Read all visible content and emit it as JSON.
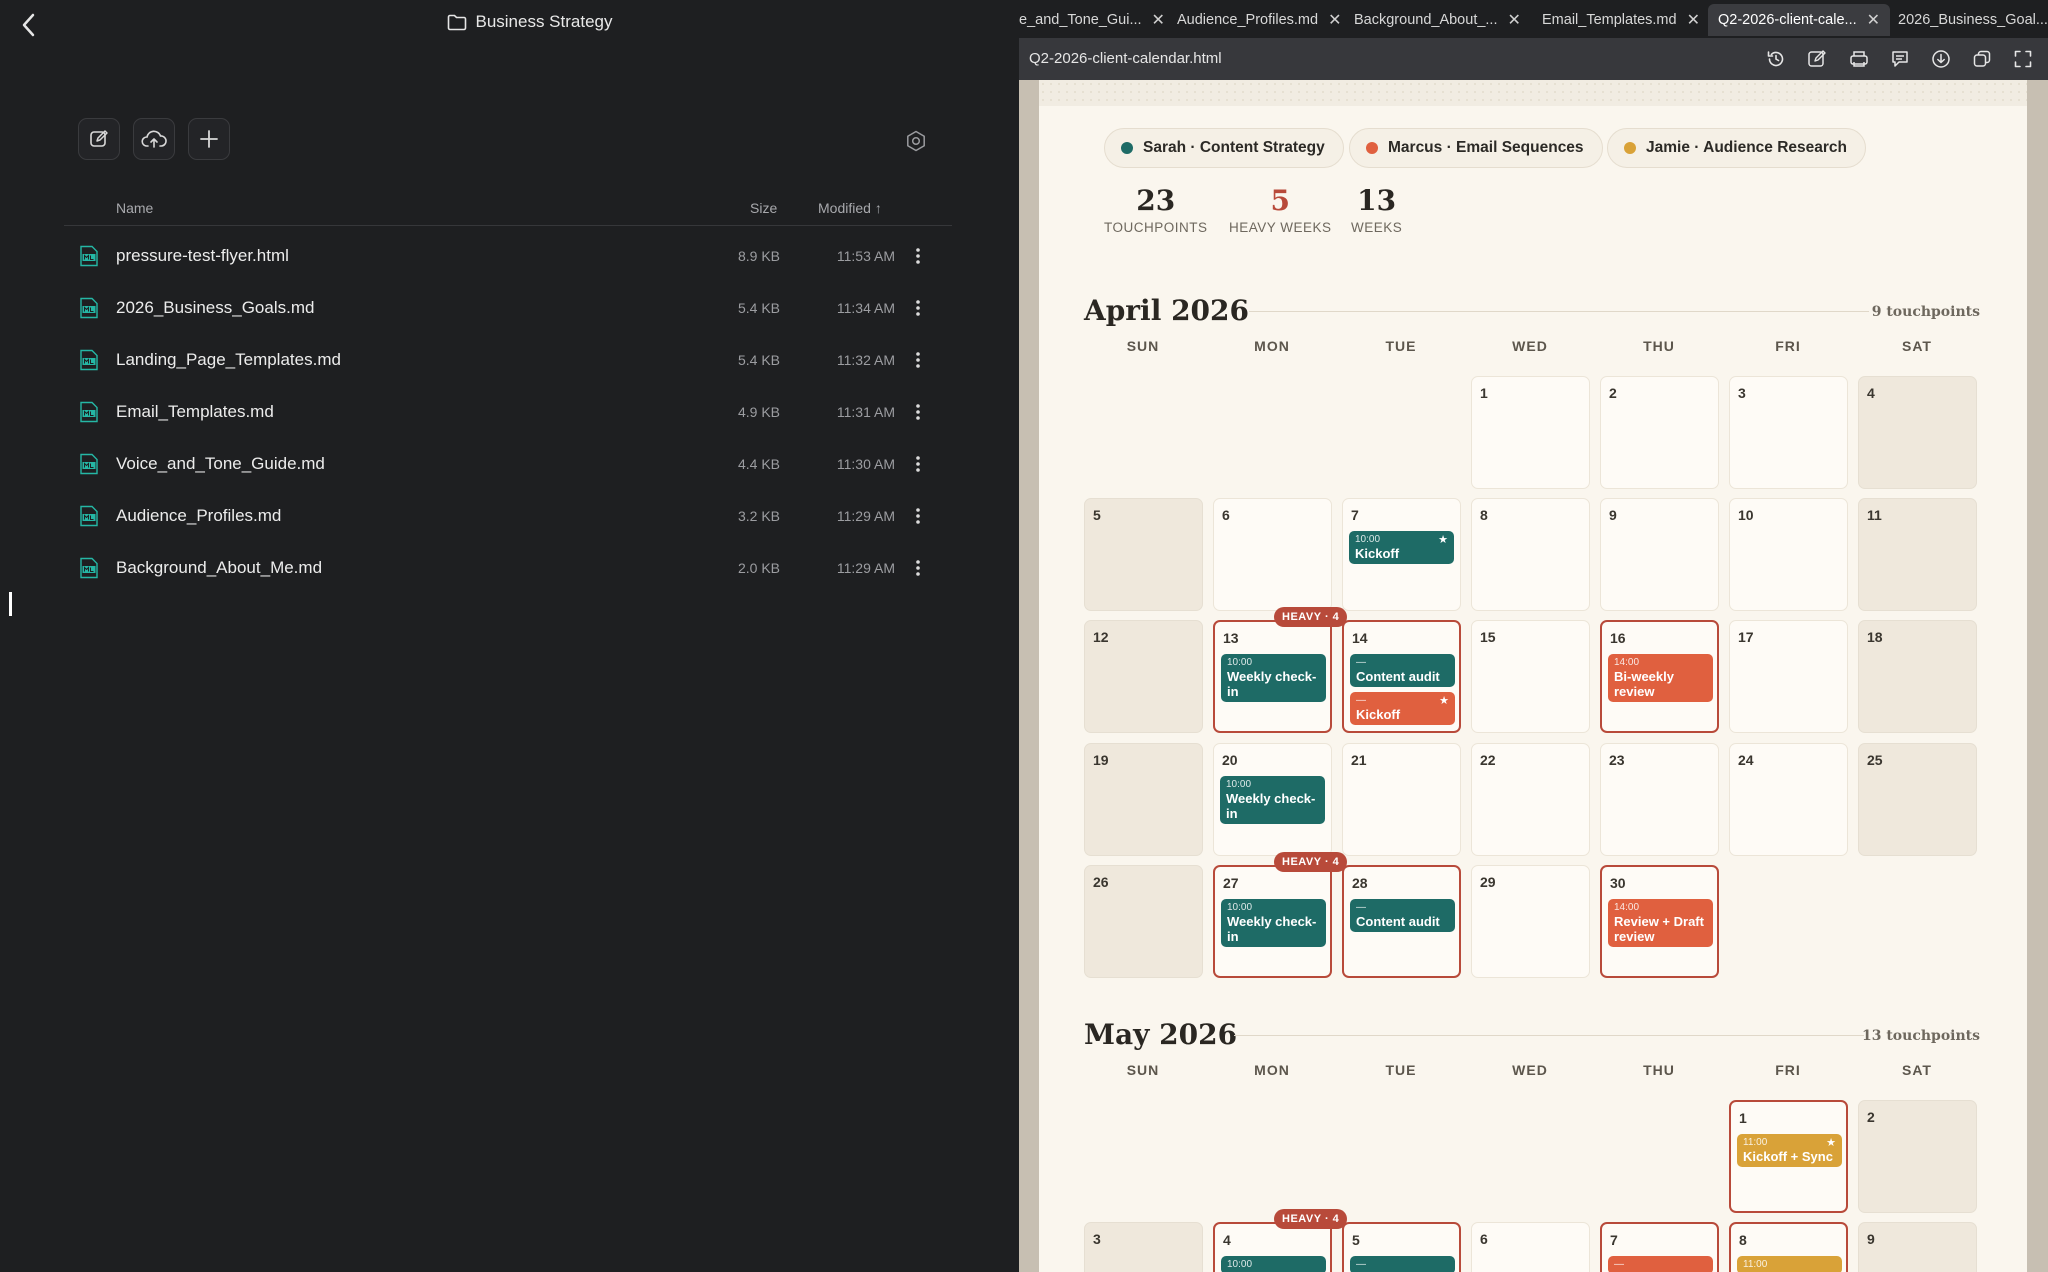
{
  "files_pane": {
    "folder_title": "Business Strategy",
    "columns": {
      "name": "Name",
      "size": "Size",
      "modified": "Modified"
    },
    "files": [
      {
        "name": "pressure-test-flyer.html",
        "size": "8.9 KB",
        "modified": "11:53 AM",
        "type": "HTML"
      },
      {
        "name": "2026_Business_Goals.md",
        "size": "5.4 KB",
        "modified": "11:34 AM",
        "type": "MD"
      },
      {
        "name": "Landing_Page_Templates.md",
        "size": "5.4 KB",
        "modified": "11:32 AM",
        "type": "MD"
      },
      {
        "name": "Email_Templates.md",
        "size": "4.9 KB",
        "modified": "11:31 AM",
        "type": "MD"
      },
      {
        "name": "Voice_and_Tone_Guide.md",
        "size": "4.4 KB",
        "modified": "11:30 AM",
        "type": "MD"
      },
      {
        "name": "Audience_Profiles.md",
        "size": "3.2 KB",
        "modified": "11:29 AM",
        "type": "MD"
      },
      {
        "name": "Background_About_Me.md",
        "size": "2.0 KB",
        "modified": "11:29 AM",
        "type": "MD"
      }
    ]
  },
  "tabs": [
    {
      "label": "e_and_Tone_Gui..."
    },
    {
      "label": "Audience_Profiles.md"
    },
    {
      "label": "Background_About_..."
    },
    {
      "label": "Email_Templates.md"
    },
    {
      "label": "Q2-2026-client-cale...",
      "active": true
    },
    {
      "label": "2026_Business_Goal..."
    }
  ],
  "document": {
    "title": "Q2-2026-client-calendar.html",
    "toolbar_icons": [
      "history-icon",
      "edit-icon",
      "print-icon",
      "comment-icon",
      "download-icon",
      "duplicate-icon",
      "fullscreen-icon"
    ]
  },
  "calendar": {
    "colors": {
      "sarah": "#1e6b66",
      "marcus": "#e0603f",
      "jamie": "#d9a238",
      "heavy": "#b84a3a"
    },
    "legend": [
      {
        "label": "Sarah · Content Strategy",
        "color": "#1e6b66"
      },
      {
        "label": "Marcus · Email Sequences",
        "color": "#e0603f"
      },
      {
        "label": "Jamie · Audience Research",
        "color": "#d9a238"
      }
    ],
    "stats": [
      {
        "value": "23",
        "label": "TOUCHPOINTS"
      },
      {
        "value": "5",
        "label": "HEAVY WEEKS",
        "accent": true
      },
      {
        "value": "13",
        "label": "WEEKS"
      }
    ],
    "weekdays": [
      "SUN",
      "MON",
      "TUE",
      "WED",
      "THU",
      "FRI",
      "SAT"
    ],
    "april": {
      "title": "April 2026",
      "count": "9 touchpoints",
      "heavy_label": "HEAVY · 4",
      "cells": [
        {
          "day": "1"
        },
        {
          "day": "2"
        },
        {
          "day": "3"
        },
        {
          "day": "4"
        },
        {
          "day": "5"
        },
        {
          "day": "6"
        },
        {
          "day": "7",
          "events": [
            {
              "time": "10:00",
              "title": "Kickoff",
              "owner": "sarah",
              "star": "★"
            }
          ]
        },
        {
          "day": "8"
        },
        {
          "day": "9"
        },
        {
          "day": "10"
        },
        {
          "day": "11"
        },
        {
          "day": "12"
        },
        {
          "day": "13",
          "events": [
            {
              "time": "10:00",
              "title": "Weekly check-in",
              "owner": "sarah"
            }
          ]
        },
        {
          "day": "14",
          "events": [
            {
              "time": "—",
              "title": "Content audit",
              "owner": "sarah"
            },
            {
              "time": "—",
              "title": "Kickoff",
              "owner": "marcus",
              "star": "★"
            }
          ]
        },
        {
          "day": "15"
        },
        {
          "day": "16",
          "events": [
            {
              "time": "14:00",
              "title": "Bi-weekly review",
              "owner": "marcus"
            }
          ]
        },
        {
          "day": "17"
        },
        {
          "day": "18"
        },
        {
          "day": "19"
        },
        {
          "day": "20",
          "events": [
            {
              "time": "10:00",
              "title": "Weekly check-in",
              "owner": "sarah"
            }
          ]
        },
        {
          "day": "21"
        },
        {
          "day": "22"
        },
        {
          "day": "23"
        },
        {
          "day": "24"
        },
        {
          "day": "25"
        },
        {
          "day": "26"
        },
        {
          "day": "27",
          "events": [
            {
              "time": "10:00",
              "title": "Weekly check-in",
              "owner": "sarah"
            }
          ]
        },
        {
          "day": "28",
          "events": [
            {
              "time": "—",
              "title": "Content audit",
              "owner": "sarah"
            }
          ]
        },
        {
          "day": "29"
        },
        {
          "day": "30",
          "events": [
            {
              "time": "14:00",
              "title": "Review + Draft review",
              "owner": "marcus"
            }
          ]
        }
      ]
    },
    "may": {
      "title": "May 2026",
      "count": "13 touchpoints",
      "heavy_label": "HEAVY · 4",
      "cells": [
        {
          "day": "1",
          "events": [
            {
              "time": "11:00",
              "title": "Kickoff + Sync",
              "owner": "jamie",
              "star": "★"
            }
          ]
        },
        {
          "day": "2"
        },
        {
          "day": "3"
        },
        {
          "day": "4",
          "events": [
            {
              "time": "10:00",
              "title": "",
              "owner": "sarah"
            }
          ]
        },
        {
          "day": "5",
          "events": [
            {
              "time": "—",
              "title": "",
              "owner": "sarah"
            }
          ]
        },
        {
          "day": "6"
        },
        {
          "day": "7",
          "events": [
            {
              "time": "—",
              "title": "",
              "owner": "marcus"
            }
          ]
        },
        {
          "day": "8",
          "events": [
            {
              "time": "11:00",
              "title": "",
              "owner": "jamie"
            }
          ]
        },
        {
          "day": "9"
        }
      ]
    }
  }
}
